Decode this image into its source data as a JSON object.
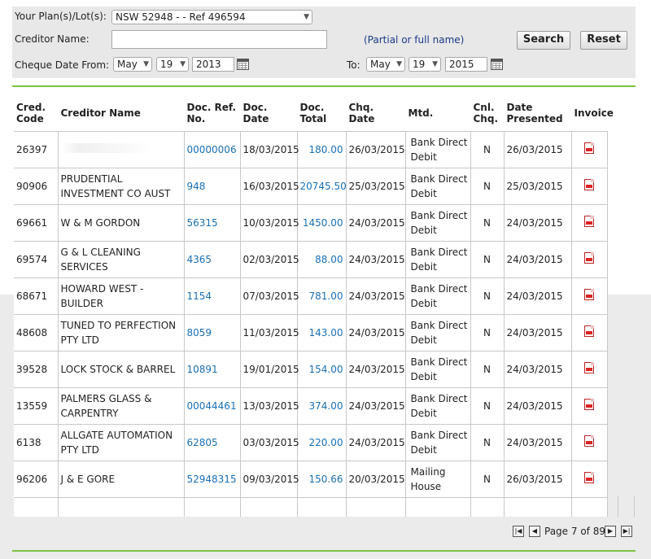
{
  "filters": {
    "plan_label": "Your Plan(s)/Lot(s):",
    "plan_value": "NSW 52948 -          - Ref 496594",
    "creditor_label": "Creditor Name:",
    "creditor_value": "",
    "creditor_hint": "(Partial or full name)",
    "search_button": "Search",
    "reset_button": "Reset",
    "date_from_label": "Cheque Date From:",
    "from_month": "May",
    "from_day": "19",
    "from_year": "2013",
    "to_label": "To:",
    "to_month": "May",
    "to_day": "19",
    "to_year": "2015"
  },
  "table": {
    "headers": {
      "cred_code_1": "Cred.",
      "cred_code_2": "Code",
      "creditor_name": "Creditor Name",
      "doc_ref_1": "Doc. Ref.",
      "doc_ref_2": "No.",
      "doc_date": "Doc. Date",
      "doc_total": "Doc. Total",
      "chq_date": "Chq. Date",
      "mtd": "Mtd.",
      "cnl_1": "Cnl.",
      "cnl_2": "Chq.",
      "date_presented_1": "Date",
      "date_presented_2": "Presented",
      "invoice": "Invoice"
    },
    "rows": [
      {
        "code": "26397",
        "name": "",
        "ref": "00000006",
        "doc_date": "18/03/2015",
        "total": "180.00",
        "chq_date": "26/03/2015",
        "mtd": "Bank Direct Debit",
        "cnl": "N",
        "presented": "26/03/2015"
      },
      {
        "code": "90906",
        "name": "PRUDENTIAL INVESTMENT CO AUST",
        "ref": "948",
        "doc_date": "16/03/2015",
        "total": "20745.50",
        "chq_date": "25/03/2015",
        "mtd": "Bank Direct Debit",
        "cnl": "N",
        "presented": "25/03/2015"
      },
      {
        "code": "69661",
        "name": "W & M GORDON",
        "ref": "56315",
        "doc_date": "10/03/2015",
        "total": "1450.00",
        "chq_date": "24/03/2015",
        "mtd": "Bank Direct Debit",
        "cnl": "N",
        "presented": "24/03/2015"
      },
      {
        "code": "69574",
        "name": "G & L CLEANING SERVICES",
        "ref": "4365",
        "doc_date": "02/03/2015",
        "total": "88.00",
        "chq_date": "24/03/2015",
        "mtd": "Bank Direct Debit",
        "cnl": "N",
        "presented": "24/03/2015"
      },
      {
        "code": "68671",
        "name": "HOWARD WEST - BUILDER",
        "ref": "1154",
        "doc_date": "07/03/2015",
        "total": "781.00",
        "chq_date": "24/03/2015",
        "mtd": "Bank Direct Debit",
        "cnl": "N",
        "presented": "24/03/2015"
      },
      {
        "code": "48608",
        "name": "TUNED TO PERFECTION PTY LTD",
        "ref": "8059",
        "doc_date": "11/03/2015",
        "total": "143.00",
        "chq_date": "24/03/2015",
        "mtd": "Bank Direct Debit",
        "cnl": "N",
        "presented": "24/03/2015"
      },
      {
        "code": "39528",
        "name": "LOCK STOCK & BARREL",
        "ref": "10891",
        "doc_date": "19/01/2015",
        "total": "154.00",
        "chq_date": "24/03/2015",
        "mtd": "Bank Direct Debit",
        "cnl": "N",
        "presented": "24/03/2015"
      },
      {
        "code": "13559",
        "name": "PALMERS GLASS & CARPENTRY",
        "ref": "00044461",
        "doc_date": "13/03/2015",
        "total": "374.00",
        "chq_date": "24/03/2015",
        "mtd": "Bank Direct Debit",
        "cnl": "N",
        "presented": "24/03/2015"
      },
      {
        "code": "6138",
        "name": "ALLGATE AUTOMATION PTY LTD",
        "ref": "62805",
        "doc_date": "03/03/2015",
        "total": "220.00",
        "chq_date": "24/03/2015",
        "mtd": "Bank Direct Debit",
        "cnl": "N",
        "presented": "24/03/2015"
      },
      {
        "code": "96206",
        "name": "J & E GORE",
        "ref": "52948315",
        "doc_date": "09/03/2015",
        "total": "150.66",
        "chq_date": "20/03/2015",
        "mtd": "Mailing House",
        "cnl": "N",
        "presented": "26/03/2015"
      }
    ]
  },
  "pager": {
    "text": "Page 7 of 89"
  },
  "icons": {
    "invoice": "pdf-icon",
    "calendar": "calendar-icon",
    "pager_first": "first-page-icon",
    "pager_prev": "prev-page-icon",
    "pager_next": "next-page-icon",
    "pager_last": "last-page-icon"
  },
  "colors": {
    "accent_line": "#7cc242",
    "link": "#1a6fb3",
    "hint": "#1a3a8a"
  }
}
